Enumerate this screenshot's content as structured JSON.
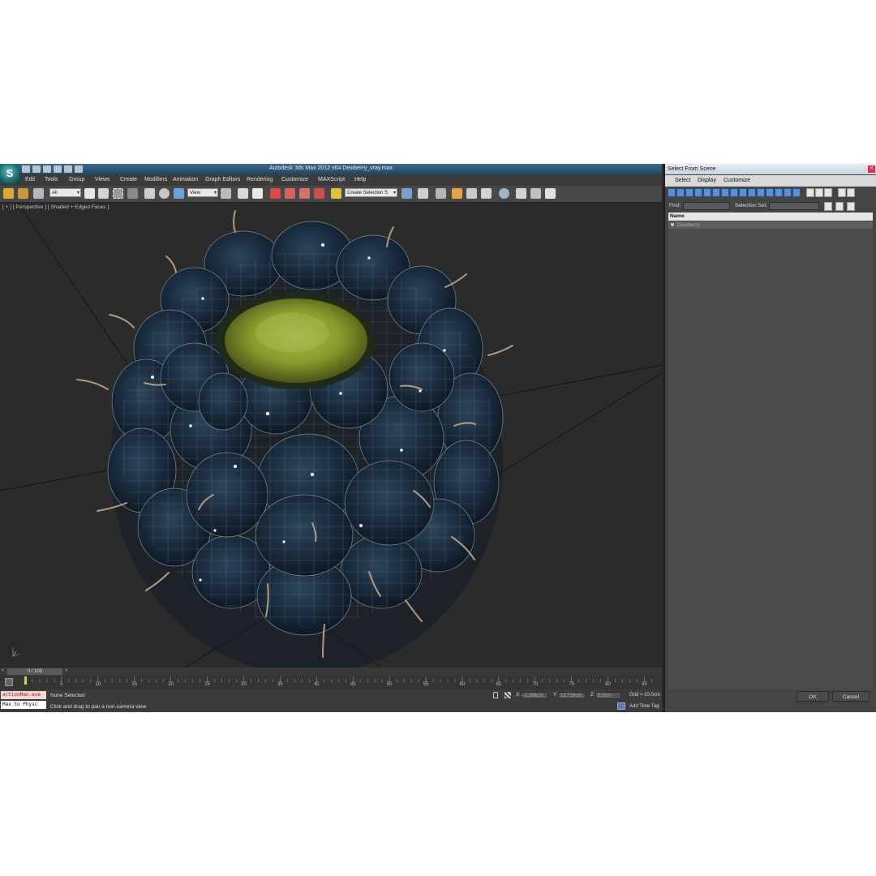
{
  "app": {
    "title": "Autodesk 3ds Max  2012 x64     Dewberry_vray.max",
    "logo_letter": "S"
  },
  "menu": [
    "Edit",
    "Tools",
    "Group",
    "Views",
    "Create",
    "Modifiers",
    "Animation",
    "Graph Editors",
    "Rendering",
    "Customize",
    "MAXScript",
    "Help"
  ],
  "toolbar": {
    "selection_filter": "All",
    "reference_coord": "View",
    "selection_set": "Create Selection S"
  },
  "viewport": {
    "label": "[ + ] [ Perspective ] [ Shaded + Edged Faces ]",
    "object": "Dewberry"
  },
  "timeline": {
    "frame_display": "0 / 100",
    "ticks": [
      "5",
      "10",
      "15",
      "20",
      "25",
      "30",
      "35",
      "40",
      "45",
      "50",
      "55",
      "60",
      "65",
      "70",
      "75",
      "80",
      "85"
    ],
    "start": 0,
    "end": 100
  },
  "status": {
    "maxscript_line1": "actionMan.exe",
    "maxscript_line2": "Max to Physc",
    "selection": "None Selected",
    "prompt": "Click and drag to pan a non-camera view",
    "x_label": "X:",
    "x_value": "-1,266cm",
    "y_label": "Y:",
    "y_value": "12,716cm",
    "z_label": "Z:",
    "z_value": "0,0cm",
    "grid": "Grid = 10,0cm",
    "add_time_tag": "Add Time Tag"
  },
  "dialog": {
    "title": "Select From Scene",
    "menu": [
      "Select",
      "Display",
      "Customize"
    ],
    "find_label": "Find:",
    "find_value": "",
    "selection_set_label": "Selection Set:",
    "selection_set_value": "",
    "column_header": "Name",
    "items": [
      "Dewberry"
    ],
    "ok": "OK",
    "cancel": "Cancel"
  }
}
